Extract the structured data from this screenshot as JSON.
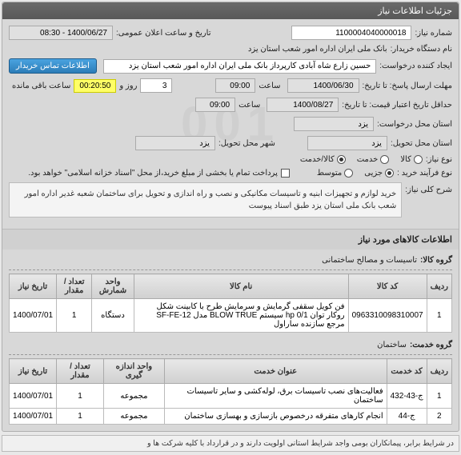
{
  "header": {
    "title": "جزئیات اطلاعات نیاز"
  },
  "info": {
    "need_number_label": "شماره نیاز:",
    "need_number": "1100004040000018",
    "announce_label": "تاریخ و ساعت اعلان عمومی:",
    "announce_value": "1400/06/27 - 08:30",
    "buyer_label": "نام دستگاه خریدار:",
    "buyer_value": "بانک ملی ایران اداره امور شعب استان یزد",
    "requester_label": "ایجاد کننده درخواست:",
    "requester_value": "حسین زارع شاه آبادی کارپرداز بانک ملی ایران اداره امور شعب استان یزد",
    "contact_btn": "اطلاعات تماس خریدار",
    "deadline_label": "مهلت ارسال پاسخ: تا تاریخ:",
    "deadline_date": "1400/06/30",
    "hour_label": "ساعت",
    "deadline_hour": "09:00",
    "day_label": "روز و",
    "days_left": "3",
    "remain_label": "ساعت باقی مانده",
    "remain_time": "00:20:50",
    "validity_label": "حداقل تاریخ اعتبار قیمت: تا تاریخ:",
    "validity_date": "1400/08/27",
    "validity_hour": "09:00",
    "request_prov_label": "استان محل درخواست:",
    "request_prov": "یزد",
    "deliver_prov_label": "استان محل تحویل:",
    "deliver_prov": "یزد",
    "deliver_city_label": "شهر محل تحویل:",
    "deliver_city": "یزد",
    "need_type_label": "نوع نیاز:",
    "need_type_goods": "کالا",
    "need_type_service": "خدمت",
    "need_type_both": "کالا/خدمت",
    "process_label": "نوع فرآیند خرید :",
    "process_low": "جزیی",
    "process_mid": "متوسط",
    "pay_note": "پرداخت تمام یا بخشی از مبلغ خرید،از محل \"اسناد خزانه اسلامی\" خواهد بود.",
    "summary_label": "شرح کلی نیاز:",
    "summary_text": "خرید لوازم و تجهیزات ابنیه و تاسیسات مکانیکی و نصب و راه اندازی و تحویل برای ساختمان شعبه غدیر اداره امور شعب بانک ملی استان یزد طبق اسناد پیوست"
  },
  "goods": {
    "section_title": "اطلاعات کالاهای مورد نیاز",
    "group_label": "گروه کالا:",
    "group_value": "تاسیسات و مصالح ساختمانی",
    "columns": [
      "ردیف",
      "کد کالا",
      "نام کالا",
      "واحد شمارش",
      "تعداد / مقدار",
      "تاریخ نیاز"
    ],
    "rows": [
      {
        "idx": "1",
        "code": "0963310098310007",
        "name": "فن کویل سقفی گرمایش و سرمایش طرح با کابینت شکل روکار توان hp 0/1 سیستم BLOW TRUE مدل SF-FE-12 مرجع سازنده ساراول",
        "unit": "دستگاه",
        "qty": "1",
        "date": "1400/07/01"
      }
    ]
  },
  "services": {
    "group_label": "گروه خدمت:",
    "group_value": "ساختمان",
    "columns": [
      "ردیف",
      "کد خدمت",
      "عنوان خدمت",
      "واحد اندازه گیری",
      "تعداد / مقدار",
      "تاریخ نیاز"
    ],
    "rows": [
      {
        "idx": "1",
        "code": "ج-43-432",
        "name": "فعالیت‌های نصب تاسیسات برق، لوله‌کشی و سایر تاسیسات ساختمان",
        "unit": "مجموعه",
        "qty": "1",
        "date": "1400/07/01"
      },
      {
        "idx": "2",
        "code": "ج-44",
        "name": "انجام کارهای متفرقه درخصوص بازسازی و بهسازی ساختمان",
        "unit": "مجموعه",
        "qty": "1",
        "date": "1400/07/01"
      }
    ]
  },
  "footer": {
    "note": "در شرایط برابر، پیمانکاران بومی واجد شرایط استانی اولویت دارند و در قرارداد با کلیه شرکت ها و"
  },
  "watermark": "001"
}
